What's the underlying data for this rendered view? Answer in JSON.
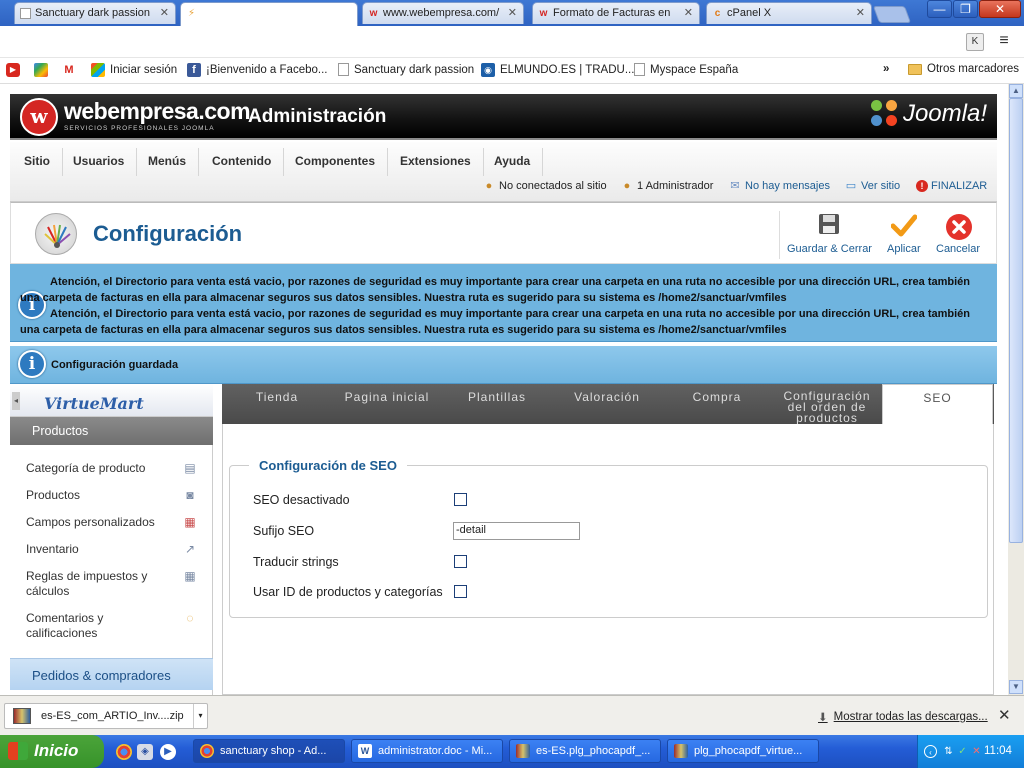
{
  "browser": {
    "tabs": [
      {
        "title": "Sanctuary dark passion",
        "icon": "page-icon"
      },
      {
        "title": "",
        "icon": "loading-icon"
      },
      {
        "title": "www.webempresa.com/",
        "icon": "webempresa-icon"
      },
      {
        "title": "Formato de Facturas en",
        "icon": "webempresa-icon"
      },
      {
        "title": "cPanel X",
        "icon": "cpanel-icon"
      }
    ],
    "window_controls": {
      "minimize": "—",
      "restore": "❐",
      "close": "✕"
    },
    "toolbar_icons": {
      "ext": "K",
      "wrench": "≡"
    },
    "bookmarks": [
      {
        "label": "",
        "icon": "youtube-icon"
      },
      {
        "label": "",
        "icon": "google-icon"
      },
      {
        "label": "",
        "icon": "gmail-icon"
      },
      {
        "label": "Iniciar sesión",
        "icon": "windows-live-icon"
      },
      {
        "label": "¡Bienvenido a Facebo...",
        "icon": "facebook-icon"
      },
      {
        "label": "Sanctuary dark passion",
        "icon": "page-icon"
      },
      {
        "label": "ELMUNDO.ES | TRADU...",
        "icon": "elmundo-icon"
      },
      {
        "label": "Myspace España",
        "icon": "page-icon"
      }
    ],
    "bookmarks_more": "»",
    "other_bookmarks": "Otros marcadores"
  },
  "header": {
    "brand": "webempresa.com",
    "brand_sub": "SERVICIOS PROFESIONALES JOOMLA",
    "title": "Administración",
    "joomla": "Joomla!"
  },
  "menu": {
    "items": [
      "Sitio",
      "Usuarios",
      "Menús",
      "Contenido",
      "Componentes",
      "Extensiones",
      "Ayuda"
    ],
    "status": {
      "offline": "No conectados al sitio",
      "admins": "1 Administrador",
      "messages": "No hay mensajes",
      "view_site": "Ver sitio",
      "logout": "FINALIZAR"
    }
  },
  "toolbar": {
    "title": "Configuración",
    "save_close": "Guardar & Cerrar",
    "apply": "Aplicar",
    "cancel": "Cancelar"
  },
  "notices": {
    "warning_1": "Atención, el Directorio para venta está vacio, por razones de seguridad es muy importante para crear una carpeta en una ruta no accesible por una dirección URL, crea también una carpeta de facturas en ella para almacenar seguros sus datos sensibles. Nuestra ruta es sugerido para su sistema es /home2/sanctuar/vmfiles",
    "warning_2": "Atención, el Directorio para venta está vacio, por razones de seguridad es muy importante para crear una carpeta en una ruta no accesible por una dirección URL, crea también una carpeta de facturas en ella para almacenar seguros sus datos sensibles. Nuestra ruta es sugerido para su sistema es /home2/sanctuar/vmfiles",
    "saved": "Configuración guardada"
  },
  "sidebar": {
    "logo": "VirtueMart",
    "section": "Productos",
    "items": [
      {
        "label": "Categoría de producto",
        "icon": "folder-icon"
      },
      {
        "label": "Productos",
        "icon": "camera-icon"
      },
      {
        "label": "Campos personalizados",
        "icon": "custom-fields-icon"
      },
      {
        "label": "Inventario",
        "icon": "chart-icon"
      },
      {
        "label": "Reglas de impuestos y cálculos",
        "icon": "calculator-icon"
      },
      {
        "label": "Comentarios y calificaciones",
        "icon": "comment-icon"
      }
    ],
    "orders": "Pedidos & compradores"
  },
  "tabs": [
    {
      "label": "Tienda",
      "active": false
    },
    {
      "label": "Pagina inicial",
      "active": false
    },
    {
      "label": "Plantillas",
      "active": false
    },
    {
      "label": "Valoración",
      "active": false
    },
    {
      "label": "Compra",
      "active": false
    },
    {
      "label": "Configuración del orden de productos",
      "active": false
    },
    {
      "label": "SEO",
      "active": true
    }
  ],
  "seo": {
    "legend": "Configuración de SEO",
    "fields": {
      "disabled": {
        "label": "SEO desactivado",
        "checked": false
      },
      "suffix": {
        "label": "Sufijo SEO",
        "value": "-detail"
      },
      "translate": {
        "label": "Traducir strings",
        "checked": false
      },
      "use_ids": {
        "label": "Usar ID de productos y categorías",
        "checked": false
      }
    }
  },
  "downloads": {
    "file": "es-ES_com_ARTIO_Inv....zip",
    "show_all": "Mostrar todas las descargas..."
  },
  "taskbar": {
    "start": "Inicio",
    "tasks": [
      {
        "label": "sanctuary shop - Ad...",
        "icon": "chrome-icon"
      },
      {
        "label": "administrator.doc - Mi...",
        "icon": "word-icon"
      },
      {
        "label": "es-ES.plg_phocapdf_...",
        "icon": "winrar-icon"
      },
      {
        "label": "plg_phocapdf_virtue...",
        "icon": "winrar-icon"
      }
    ],
    "clock": "11:04"
  },
  "colors": {
    "notice_blue": "#6fb4df",
    "heading_blue": "#1c5c92",
    "joomla_red": "#d42623"
  }
}
